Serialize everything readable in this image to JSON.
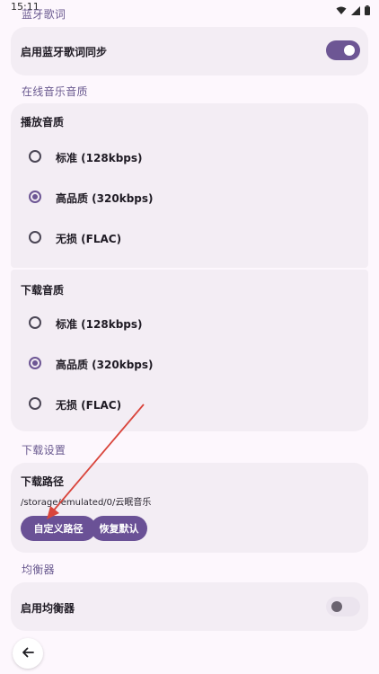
{
  "status_bar": {
    "time": "15:11",
    "icons": [
      "download-icon",
      "wifi-icon",
      "signal-icon",
      "battery-icon"
    ]
  },
  "sections": {
    "bluetooth_lyrics": {
      "header": "蓝牙歌词"
    },
    "online_quality": {
      "header": "在线音乐音质"
    },
    "download_settings": {
      "header": "下载设置"
    },
    "equalizer": {
      "header": "均衡器"
    }
  },
  "bluetooth_lyrics_sync": {
    "label": "启用蓝牙歌词同步",
    "enabled": true
  },
  "playback_quality": {
    "title": "播放音质",
    "options": [
      {
        "label": "标准 (128kbps)",
        "selected": false
      },
      {
        "label": "高品质 (320kbps)",
        "selected": true
      },
      {
        "label": "无损 (FLAC)",
        "selected": false
      }
    ]
  },
  "download_quality": {
    "title": "下载音质",
    "options": [
      {
        "label": "标准 (128kbps)",
        "selected": false
      },
      {
        "label": "高品质 (320kbps)",
        "selected": true
      },
      {
        "label": "无损 (FLAC)",
        "selected": false
      }
    ]
  },
  "download_path": {
    "title": "下载路径",
    "path": "/storage/emulated/0/云眠音乐",
    "custom_button": "自定义路径",
    "reset_button": "恢复默认"
  },
  "equalizer_toggle": {
    "label": "启用均衡器",
    "enabled": false
  },
  "colors": {
    "background": "#fdf7fd",
    "card": "#f3edf4",
    "accent": "#6d5694",
    "section_header": "#6a5a90",
    "annotation_arrow": "#d9453c"
  }
}
